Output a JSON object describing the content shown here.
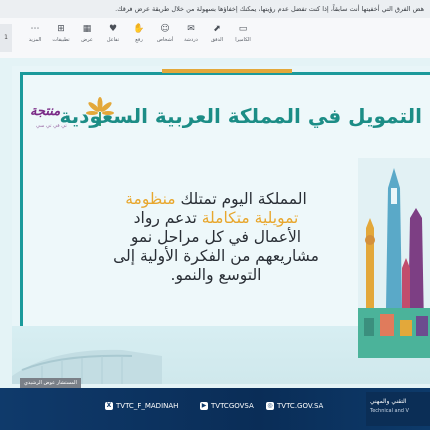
{
  "notice": {
    "text": "هض الفرق التي أخفيتها أنت سابقاً، إذا كنت تفضل عدم رؤيتها، يمكنك إخفاؤها بسهولة من خلال طريقة عرض فرقك."
  },
  "toolbar": {
    "left_label": "1",
    "buttons": [
      {
        "label": "الكاميرا",
        "icon": "camera-icon"
      },
      {
        "label": "الدفق",
        "icon": "screen-share-icon"
      },
      {
        "label": "دردشة",
        "icon": "chat-icon"
      },
      {
        "label": "أشخاص",
        "icon": "people-icon"
      },
      {
        "label": "رفع",
        "icon": "raise-hand-icon"
      },
      {
        "label": "تفاعل",
        "icon": "react-icon"
      },
      {
        "label": "عرض",
        "icon": "view-icon"
      },
      {
        "label": "تطبيقات",
        "icon": "apps-icon"
      },
      {
        "label": "المزيد",
        "icon": "more-icon"
      }
    ]
  },
  "slide": {
    "title": "التمويل في المملكة العربية السعودية",
    "logo_word": "منتجة",
    "logo_sub": "تي في تي سي",
    "body": {
      "line1_a": "المملكة اليوم تمتلك ",
      "line1_b": "منظومة",
      "line2_b": "تمويلية متكاملة",
      "line2_a": " تدعم رواد",
      "line3": "الأعمال في كل مراحل نمو",
      "line4": "مشاريعهم من الفكرة الأولية إلى",
      "line5": "التوسع والنمو."
    },
    "caption": "المستشار عوض الرشيدي"
  },
  "footer": {
    "x_handle": "TVTC_F_MADINAH",
    "youtube": "TVTCGOVSA",
    "web": "TVTC.GOV.SA",
    "brand_ar": "التقني والمهني",
    "brand_en": "Technical and V"
  },
  "colors": {
    "teal": "#1b9a9b",
    "gold": "#e8a72e",
    "navy": "#0f3a6b",
    "purple": "#7a2b87"
  }
}
